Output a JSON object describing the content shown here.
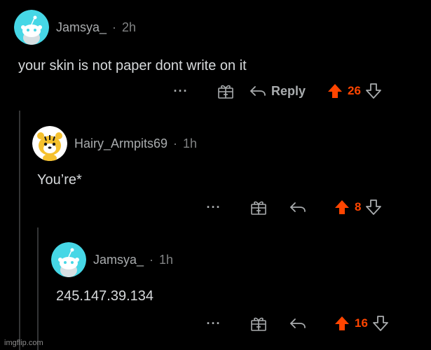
{
  "colors": {
    "background": "#000000",
    "text": "#d7dadc",
    "meta": "#818384",
    "upvote": "#ff4500",
    "icon": "#a9acae",
    "thread_line": "#343536",
    "avatar_teal": "#46d7e6"
  },
  "comments": [
    {
      "username": "Jamsya_",
      "time": "2h",
      "separator": "·",
      "text": "your skin is not paper dont write on it",
      "more_label": "···",
      "reply_label": "Reply",
      "score": "26",
      "avatar": "snoo-teal-avatar"
    },
    {
      "username": "Hairy_Armpits69",
      "time": "1h",
      "separator": "·",
      "text": "You’re*",
      "more_label": "···",
      "score": "8",
      "avatar": "snoo-tiger-avatar"
    },
    {
      "username": "Jamsya_",
      "time": "1h",
      "separator": "·",
      "text": "245.147.39.134",
      "more_label": "···",
      "score": "16",
      "avatar": "snoo-teal-avatar"
    }
  ],
  "icons": [
    "award-gift-icon",
    "reply-arrow-icon",
    "upvote-arrow-icon",
    "downvote-arrow-icon"
  ],
  "watermark": "imgflip.com"
}
